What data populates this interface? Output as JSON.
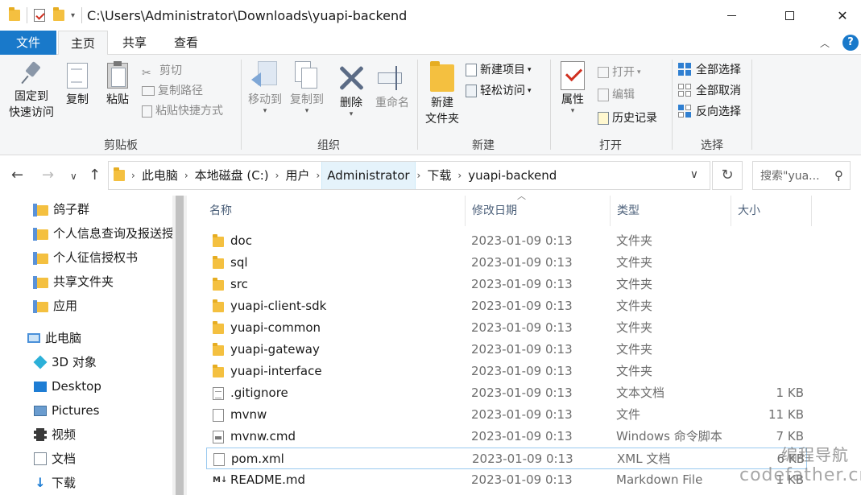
{
  "window": {
    "title": "C:\\Users\\Administrator\\Downloads\\yuapi-backend"
  },
  "tabs": {
    "file": "文件",
    "home": "主页",
    "share": "共享",
    "view": "查看"
  },
  "ribbon": {
    "clipboard": {
      "group_label": "剪贴板",
      "pin": "固定到",
      "pin2": "快速访问",
      "copy": "复制",
      "paste": "粘贴",
      "cut": "剪切",
      "copy_path": "复制路径",
      "paste_shortcut": "粘贴快捷方式"
    },
    "organize": {
      "group_label": "组织",
      "move_to": "移动到",
      "copy_to": "复制到",
      "delete": "删除",
      "rename": "重命名"
    },
    "new": {
      "group_label": "新建",
      "new_folder": "新建",
      "new_folder2": "文件夹",
      "new_item": "新建项目",
      "easy_access": "轻松访问"
    },
    "open": {
      "group_label": "打开",
      "properties": "属性",
      "open": "打开",
      "edit": "编辑",
      "history": "历史记录"
    },
    "select": {
      "group_label": "选择",
      "select_all": "全部选择",
      "select_none": "全部取消",
      "invert": "反向选择"
    }
  },
  "address": {
    "crumbs": [
      "此电脑",
      "本地磁盘 (C:)",
      "用户",
      "Administrator",
      "下载",
      "yuapi-backend"
    ],
    "search_placeholder": "搜索\"yua..."
  },
  "nav": {
    "items": [
      "鸽子群",
      "个人信息查询及报送授",
      "个人征信授权书",
      "共享文件夹",
      "应用",
      "此电脑",
      "3D 对象",
      "Desktop",
      "Pictures",
      "视频",
      "文档",
      "下载"
    ]
  },
  "columns": {
    "name": "名称",
    "date": "修改日期",
    "type": "类型",
    "size": "大小"
  },
  "files": [
    {
      "name": "doc",
      "date": "2023-01-09 0:13",
      "type": "文件夹",
      "size": "",
      "icon": "folder-icon"
    },
    {
      "name": "sql",
      "date": "2023-01-09 0:13",
      "type": "文件夹",
      "size": "",
      "icon": "folder-icon"
    },
    {
      "name": "src",
      "date": "2023-01-09 0:13",
      "type": "文件夹",
      "size": "",
      "icon": "folder-icon"
    },
    {
      "name": "yuapi-client-sdk",
      "date": "2023-01-09 0:13",
      "type": "文件夹",
      "size": "",
      "icon": "folder-icon"
    },
    {
      "name": "yuapi-common",
      "date": "2023-01-09 0:13",
      "type": "文件夹",
      "size": "",
      "icon": "folder-icon"
    },
    {
      "name": "yuapi-gateway",
      "date": "2023-01-09 0:13",
      "type": "文件夹",
      "size": "",
      "icon": "folder-icon"
    },
    {
      "name": "yuapi-interface",
      "date": "2023-01-09 0:13",
      "type": "文件夹",
      "size": "",
      "icon": "folder-icon"
    },
    {
      "name": ".gitignore",
      "date": "2023-01-09 0:13",
      "type": "文本文档",
      "size": "1 KB",
      "icon": "text-file-icon"
    },
    {
      "name": "mvnw",
      "date": "2023-01-09 0:13",
      "type": "文件",
      "size": "11 KB",
      "icon": "blank-file-icon"
    },
    {
      "name": "mvnw.cmd",
      "date": "2023-01-09 0:13",
      "type": "Windows 命令脚本",
      "size": "7 KB",
      "icon": "cmd-file-icon"
    },
    {
      "name": "pom.xml",
      "date": "2023-01-09 0:13",
      "type": "XML 文档",
      "size": "6 KB",
      "icon": "blank-file-icon"
    },
    {
      "name": "README.md",
      "date": "2023-01-09 0:13",
      "type": "Markdown File",
      "size": "1 KB",
      "icon": "markdown-file-icon"
    }
  ],
  "watermark": {
    "line1": "编程导航",
    "line2": "codefather.cn"
  }
}
